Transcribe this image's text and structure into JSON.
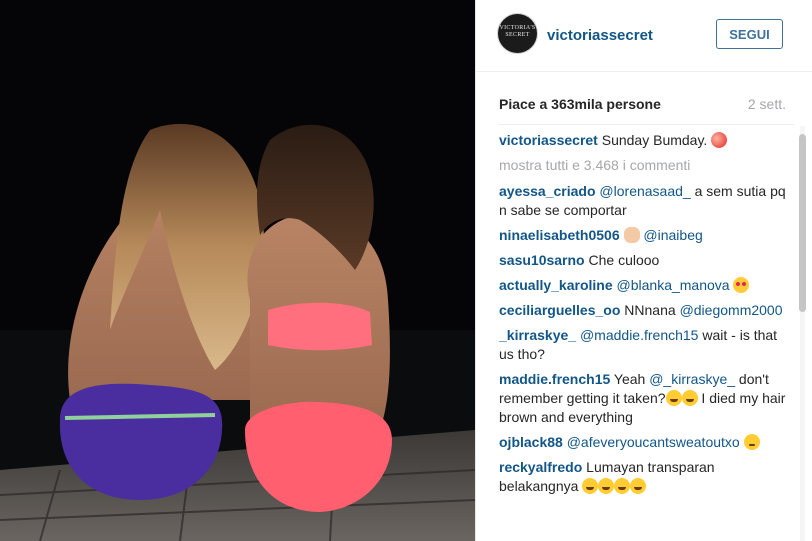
{
  "post": {
    "photo_description_icon": "photo"
  },
  "header": {
    "avatar_text": "VICTORIA'S SECRET",
    "username": "victoriassecret",
    "follow_label": "SEGUI"
  },
  "stats": {
    "likes_text": "Piace a 363mila persone",
    "time_text": "2 sett."
  },
  "caption": {
    "user": "victoriassecret",
    "text": "Sunday Bumday.",
    "emoji": "peach-emoji"
  },
  "more_comments": "mostra tutti e 3.468 i commenti",
  "comments": [
    {
      "user": "ayessa_criado",
      "mention": "@lorenasaad_",
      "text": "a sem sutia pq n sabe se comportar"
    },
    {
      "user": "ninaelisabeth0506",
      "emoji": "ok-hand-emoji",
      "mention": "@inaibeg"
    },
    {
      "user": "sasu10sarno",
      "text": "Che culooo"
    },
    {
      "user": "actually_karoline",
      "mention": "@blanka_manova",
      "emoji": "heart-eyes-emoji"
    },
    {
      "user": "ceciliarguelles_oo",
      "text": "NNnana",
      "mention": "@diegomm2000"
    },
    {
      "user": "_kirraskye_",
      "mention": "@maddie.french15",
      "text": "wait - is that us tho?"
    },
    {
      "user": "maddie.french15",
      "text_before": "Yeah",
      "mention": "@_kirraskye_",
      "text": "don't remember getting it taken?",
      "text_after": "I died my hair brown and everything"
    },
    {
      "user": "ojblack88",
      "mention": "@afeveryoucantsweatoutxo"
    },
    {
      "user": "reckyalfredo",
      "text": "Lumayan transparan belakangnya"
    }
  ],
  "colors": {
    "link": "#125688",
    "follow": "#3f729b",
    "muted": "#a5a7aa"
  }
}
